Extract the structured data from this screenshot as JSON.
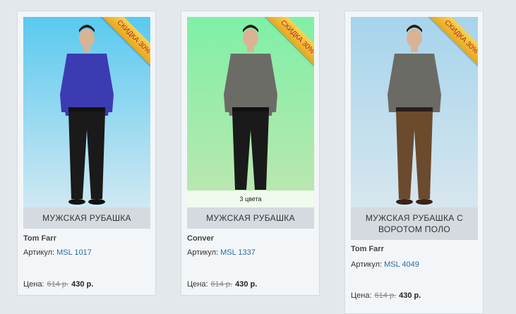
{
  "products": [
    {
      "badge": "СКИДКА 30%",
      "title": "МУЖСКАЯ РУБАШКА",
      "brand": "Tom Farr",
      "sku_label": "Артикул:",
      "sku": "MSL 1017",
      "price_label": "Цена:",
      "old_price": "614 р.",
      "new_price": "430 р.",
      "colors": {
        "bg_top": "#5ac9f0",
        "bg_bottom": "#cfe8f2",
        "shirt": "#3c3bb2",
        "pants": "#1a1a1a"
      }
    },
    {
      "badge": "СКИДКА 30%",
      "title": "МУЖСКАЯ РУБАШКА",
      "brand": "Conver",
      "sku_label": "Артикул:",
      "sku": "MSL 1337",
      "price_label": "Цена:",
      "old_price": "614 р.",
      "new_price": "430 р.",
      "color_count": "3 цвета",
      "colors": {
        "bg_top": "#7ff0a6",
        "bg_bottom": "#bfe6b0",
        "shirt": "#6c6c66",
        "pants": "#1a1a1a"
      }
    },
    {
      "badge": "СКИДКА 30%",
      "title": "МУЖСКАЯ РУБАШКА С ВОРОТОМ ПОЛО",
      "brand": "Tom Farr",
      "sku_label": "Артикул:",
      "sku": "MSL 4049",
      "price_label": "Цена:",
      "old_price": "614 р.",
      "new_price": "430 р.",
      "colors": {
        "bg_top": "#a6d4ec",
        "bg_bottom": "#d7e6ee",
        "shirt": "#6b6b66",
        "pants": "#6b4a2e"
      }
    }
  ]
}
